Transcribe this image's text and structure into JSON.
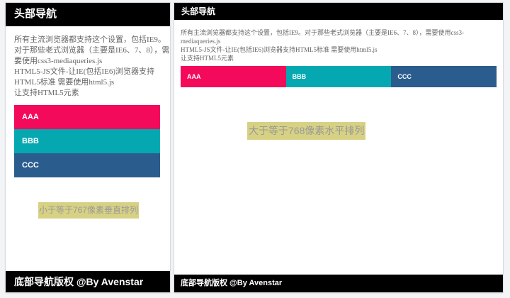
{
  "mobile_view": {
    "header_title": "头部导航",
    "intro_lines": [
      "所有主流浏览器都支持这个设置，包括IE9。对于那些老式浏览器（主要是IE6、7、8），需要使用css3-mediaqueries.js",
      "HTML5-JS文件-让IE(包括IE6)浏览器支持HTML5标准 需要使用html5.js",
      "让支持HTML5元素"
    ],
    "nav_items": [
      {
        "label": "AAA",
        "color": "#f30a5a"
      },
      {
        "label": "BBB",
        "color": "#05a8b1"
      },
      {
        "label": "CCC",
        "color": "#2a5d8e"
      }
    ],
    "caption": "小于等于767像素垂直排列",
    "footer_prefix": "底部导航版权",
    "footer_suffix": " @By Avenstar"
  },
  "desktop_view": {
    "header_title": "头部导航",
    "intro_lines": [
      "所有主流浏览器都支持这个设置，包括IE9。对于那些老式浏览器（主要是IE6、7、8），需要使用css3-mediaqueries.js",
      "HTML5-JS文件-让IE(包括IE6)浏览器支持HTML5标准 需要使用html5.js",
      "让支持HTML5元素"
    ],
    "nav_items": [
      {
        "label": "AAA",
        "color": "#f30a5a"
      },
      {
        "label": "BBB",
        "color": "#05a8b1"
      },
      {
        "label": "CCC",
        "color": "#2a5d8e"
      }
    ],
    "caption": "大于等于768像素水平排列",
    "footer_prefix": "底部导航版权",
    "footer_suffix": " @By Avenstar"
  },
  "colors": {
    "header_bg": "#000000",
    "footer_bg": "#000000",
    "caption_bg": "#d7d184",
    "caption_text": "#999999",
    "body_text": "#666666"
  }
}
